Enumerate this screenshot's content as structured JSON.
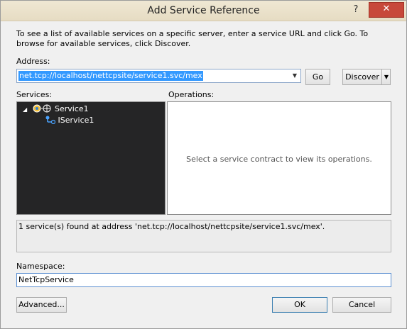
{
  "window": {
    "title": "Add Service Reference",
    "help_icon": "question-mark-icon",
    "close_icon": "close-icon",
    "close_glyph": "✕",
    "help_glyph": "?"
  },
  "intro_text": "To see a list of available services on a specific server, enter a service URL and click Go. To browse for available services, click Discover.",
  "address": {
    "label": "Address:",
    "value": "net.tcp://localhost/nettcpsite/service1.svc/mex",
    "go_label": "Go",
    "discover_label": "Discover"
  },
  "services": {
    "label": "Services:",
    "tree": [
      {
        "label": "Service1",
        "icon": "service-icon",
        "expanded": true
      },
      {
        "label": "IService1",
        "icon": "contract-interface-icon"
      }
    ]
  },
  "operations": {
    "label": "Operations:",
    "placeholder": "Select a service contract to view its operations."
  },
  "status_text": "1 service(s) found at address 'net.tcp://localhost/nettcpsite/service1.svc/mex'.",
  "namespace": {
    "label": "Namespace:",
    "value": "NetTcpService"
  },
  "buttons": {
    "advanced": "Advanced...",
    "ok": "OK",
    "cancel": "Cancel"
  },
  "colors": {
    "title_bar": "#ebe3cb",
    "close_button": "#c7483a",
    "selection": "#3399ff",
    "tree_background": "#252526"
  }
}
